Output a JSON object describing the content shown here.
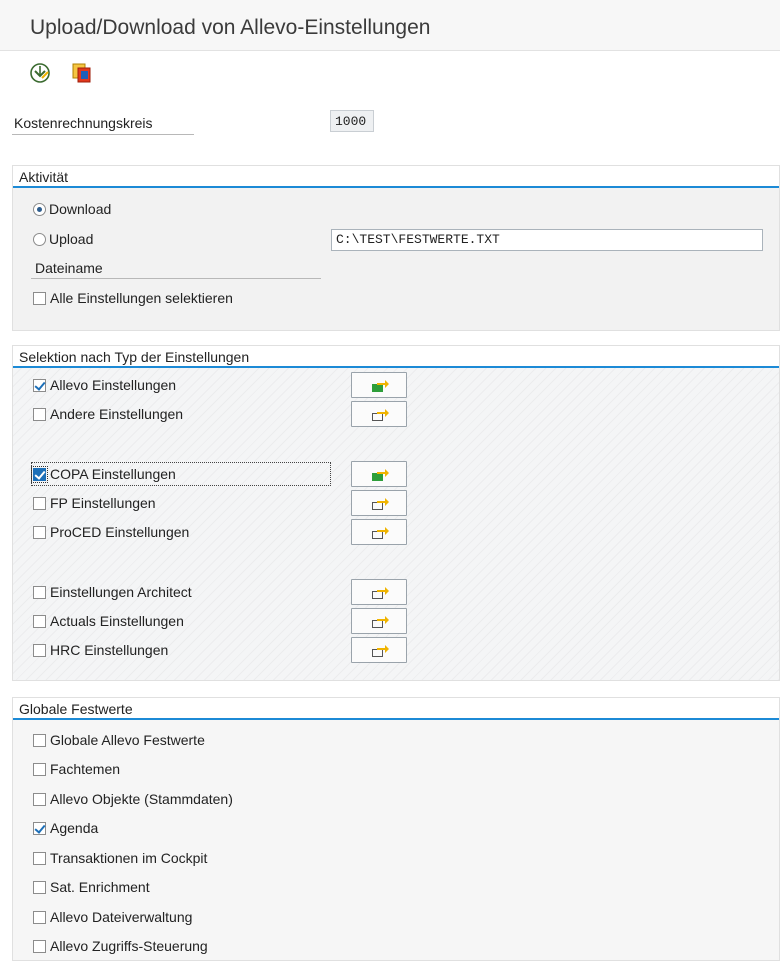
{
  "window": {
    "title": "Upload/Download von Allevo-Einstellungen"
  },
  "toolbar": {
    "execute_icon": "execute-icon",
    "copy_icon": "copy-icon"
  },
  "header_fields": {
    "kostenrechnungskreis_label": "Kostenrechnungskreis",
    "kostenrechnungskreis_value": "1000"
  },
  "aktivitaet": {
    "title": "Aktivität",
    "download_label": "Download",
    "download_selected": true,
    "upload_label": "Upload",
    "upload_selected": false,
    "dateiname_label": "Dateiname",
    "dateiname_value": "C:\\TEST\\FESTWERTE.TXT",
    "alle_label": "Alle Einstellungen selektieren",
    "alle_checked": false
  },
  "selektion": {
    "title": "Selektion nach Typ der Einstellungen",
    "items": [
      {
        "label": "Allevo Einstellungen",
        "checked": true,
        "button_icon": "green-transfer-icon"
      },
      {
        "label": "Andere Einstellungen",
        "checked": false,
        "button_icon": "folder-transfer-icon"
      },
      {
        "label": "COPA Einstellungen",
        "checked": true,
        "button_icon": "green-transfer-icon"
      },
      {
        "label": "FP Einstellungen",
        "checked": false,
        "button_icon": "folder-transfer-icon"
      },
      {
        "label": "ProCED Einstellungen",
        "checked": false,
        "button_icon": "folder-transfer-icon"
      },
      {
        "label": "Einstellungen Architect",
        "checked": false,
        "button_icon": "folder-transfer-icon"
      },
      {
        "label": "Actuals Einstellungen",
        "checked": false,
        "button_icon": "folder-transfer-icon"
      },
      {
        "label": "HRC Einstellungen",
        "checked": false,
        "button_icon": "folder-transfer-icon"
      }
    ]
  },
  "globale": {
    "title": "Globale Festwerte",
    "items": [
      {
        "label": "Globale Allevo Festwerte",
        "checked": false
      },
      {
        "label": "Fachtemen",
        "checked": false
      },
      {
        "label": "Allevo Objekte (Stammdaten)",
        "checked": false
      },
      {
        "label": "Agenda",
        "checked": true
      },
      {
        "label": "Transaktionen im Cockpit",
        "checked": false
      },
      {
        "label": "Sat. Enrichment",
        "checked": false
      },
      {
        "label": "Allevo Dateiverwaltung",
        "checked": false
      },
      {
        "label": "Allevo Zugriffs-Steuerung",
        "checked": false
      }
    ]
  },
  "colors": {
    "accent": "#1c8ad6",
    "check": "#1c6fb8",
    "green": "#2e9e3a",
    "yellow": "#f0b400"
  }
}
